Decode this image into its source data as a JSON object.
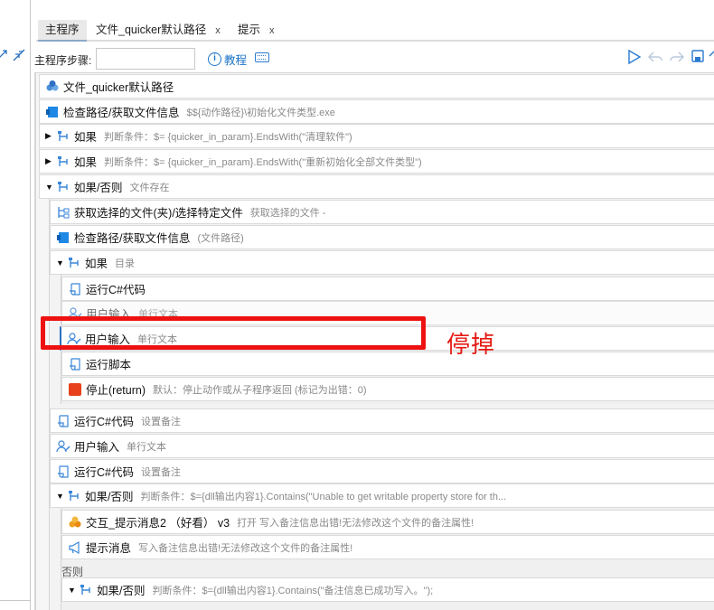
{
  "tabs": [
    {
      "label": "主程序",
      "closable": false,
      "active": true
    },
    {
      "label": "文件_quicker默认路径",
      "closable": true,
      "close": "x"
    },
    {
      "label": "提示",
      "closable": true,
      "close": "x"
    }
  ],
  "toolbar": {
    "steps_label": "主程序步骤:",
    "steps_value": "",
    "help_label": "教程",
    "help_icon_text": "i"
  },
  "rows": [
    {
      "label": "文件_quicker默认路径",
      "desc": "",
      "icon": "subprogram-icon"
    },
    {
      "label": "检查路径/获取文件信息",
      "desc": "$${动作路径}\\初始化文件类型.exe",
      "icon": "file-info-icon"
    },
    {
      "label": "如果",
      "desc": "判断条件：$= {quicker_in_param}.EndsWith(\"清理软件\")",
      "icon": "branch-icon",
      "toggle": "▶"
    },
    {
      "label": "如果",
      "desc": "判断条件：$= {quicker_in_param}.EndsWith(\"重新初始化全部文件类型\")",
      "icon": "branch-icon",
      "toggle": "▶"
    },
    {
      "label": "如果/否则",
      "desc": "文件存在",
      "icon": "branch-icon",
      "toggle": "▼"
    },
    {
      "label": "获取选择的文件(夹)/选择特定文件",
      "desc": "获取选择的文件 -",
      "icon": "tree-icon"
    },
    {
      "label": "检查路径/获取文件信息",
      "desc": "(文件路径)",
      "icon": "file-info-icon"
    },
    {
      "label": "如果",
      "desc": "目录",
      "icon": "branch-icon",
      "toggle": "▼"
    },
    {
      "label": "运行C#代码",
      "desc": "",
      "icon": "script-icon"
    },
    {
      "label": "用户输入",
      "desc": "单行文本",
      "icon": "user-input-icon"
    },
    {
      "label": "用户输入",
      "desc": "单行文本",
      "icon": "user-input-icon"
    },
    {
      "label": "运行脚本",
      "desc": "",
      "icon": "script-icon"
    },
    {
      "label": "停止(return)",
      "desc": "默认：停止动作或从子程序返回 (标记为出错：0)",
      "icon": "stop-icon"
    },
    {
      "label": "运行C#代码",
      "desc": "设置备注",
      "icon": "script-icon"
    },
    {
      "label": "用户输入",
      "desc": "单行文本",
      "icon": "user-input-icon"
    },
    {
      "label": "运行C#代码",
      "desc": "设置备注",
      "icon": "script-icon"
    },
    {
      "label": "如果/否则",
      "desc": "判断条件：$={dll输出内容1}.Contains(\"Unable to get writable property store for th...",
      "icon": "branch-icon",
      "toggle": "▼"
    },
    {
      "label": "交互_提示消息2 （好看） v3",
      "desc": "打开 写入备注信息出错!无法修改这个文件的备注属性!",
      "icon": "subprogram-icon"
    },
    {
      "label": "提示消息",
      "desc": "写入备注信息出错!无法修改这个文件的备注属性!",
      "icon": "megaphone-icon"
    },
    {
      "label": "如果/否则",
      "desc": "判断条件：$={dll输出内容1}.Contains(\"备注信息已成功写入。\");",
      "icon": "branch-icon",
      "toggle": "▼"
    }
  ],
  "else_label": "否则",
  "annotation": {
    "text": "停掉",
    "color": "#e41b13"
  },
  "colors": {
    "accent": "#2d6fc4",
    "tab_active_bg": "#e9e9e9",
    "stop_red": "#e8401c"
  }
}
